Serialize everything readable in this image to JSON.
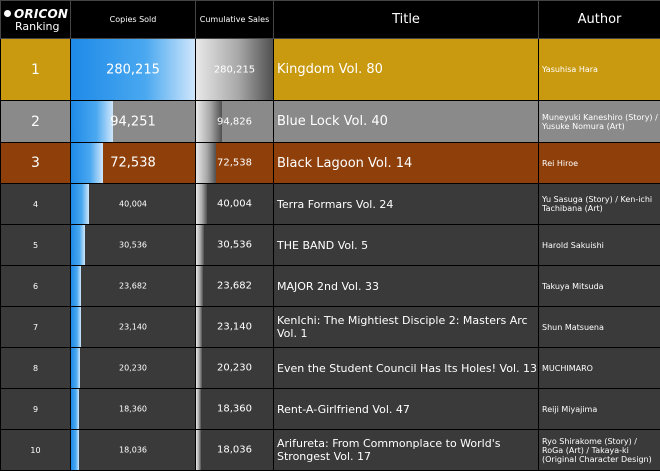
{
  "header": {
    "brand": "ORICON",
    "ranking_label": "Ranking",
    "copies_sold": "Copies Sold",
    "cumulative_sales": "Cumulative Sales",
    "title": "Title",
    "author": "Author"
  },
  "rows": [
    {
      "rank": "1",
      "copies": "280,215",
      "copies_value": 280215,
      "cumulative": "280,215",
      "cumulative_value": 280215,
      "title": "Kingdom Vol. 80",
      "author": "Yasuhisa Hara"
    },
    {
      "rank": "2",
      "copies": "94,251",
      "copies_value": 94251,
      "cumulative": "94,826",
      "cumulative_value": 94826,
      "title": "Blue Lock Vol. 40",
      "author": "Muneyuki Kaneshiro (Story) / Yusuke Nomura (Art)"
    },
    {
      "rank": "3",
      "copies": "72,538",
      "copies_value": 72538,
      "cumulative": "72,538",
      "cumulative_value": 72538,
      "title": "Black Lagoon Vol. 14",
      "author": "Rei Hiroe"
    },
    {
      "rank": "4",
      "copies": "40,004",
      "copies_value": 40004,
      "cumulative": "40,004",
      "cumulative_value": 40004,
      "title": "Terra Formars Vol. 24",
      "author": "Yu Sasuga (Story) / Ken-ichi Tachibana (Art)"
    },
    {
      "rank": "5",
      "copies": "30,536",
      "copies_value": 30536,
      "cumulative": "30,536",
      "cumulative_value": 30536,
      "title": "THE BAND Vol. 5",
      "author": "Harold Sakuishi"
    },
    {
      "rank": "6",
      "copies": "23,682",
      "copies_value": 23682,
      "cumulative": "23,682",
      "cumulative_value": 23682,
      "title": "MAJOR 2nd Vol. 33",
      "author": "Takuya Mitsuda"
    },
    {
      "rank": "7",
      "copies": "23,140",
      "copies_value": 23140,
      "cumulative": "23,140",
      "cumulative_value": 23140,
      "title": "KenIchi: The Mightiest Disciple 2: Masters Arc Vol. 1",
      "author": "Shun Matsuena"
    },
    {
      "rank": "8",
      "copies": "20,230",
      "copies_value": 20230,
      "cumulative": "20,230",
      "cumulative_value": 20230,
      "title": "Even the Student Council Has Its Holes! Vol. 13",
      "author": "MUCHIMARO"
    },
    {
      "rank": "9",
      "copies": "18,360",
      "copies_value": 18360,
      "cumulative": "18,360",
      "cumulative_value": 18360,
      "title": "Rent-A-Girlfriend Vol. 47",
      "author": "Reiji Miyajima"
    },
    {
      "rank": "10",
      "copies": "18,036",
      "copies_value": 18036,
      "cumulative": "18,036",
      "cumulative_value": 18036,
      "title": "Arifureta: From Commonplace to World's Strongest Vol. 17",
      "author": "Ryo Shirakome (Story) / RoGa (Art) / Takaya-ki (Original Character Design)"
    }
  ],
  "colors": {
    "gold": "#c99a10",
    "silver": "#8a8a8a",
    "bronze": "#8e3f0a",
    "other": "#3a3a3a",
    "bar_blue": "#1e8ae8"
  }
}
